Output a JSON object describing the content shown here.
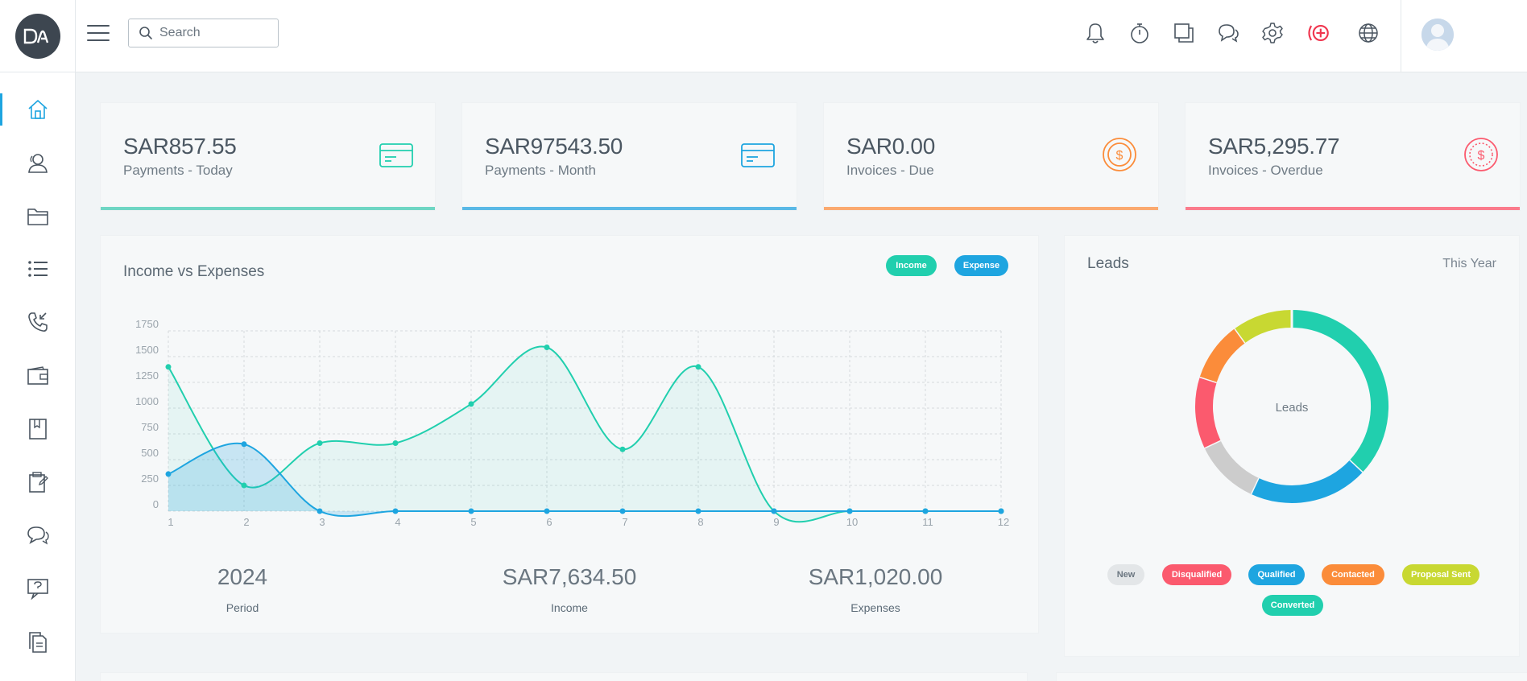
{
  "topbar": {
    "logo_text": "DA",
    "search_placeholder": "Search",
    "icons": [
      "bell-icon",
      "timer-icon",
      "copy-icon",
      "chat-icon",
      "gear-icon",
      "add-circle-icon",
      "globe-icon"
    ]
  },
  "sidebar": {
    "items": [
      "home-icon",
      "contacts-icon",
      "folder-icon",
      "list-icon",
      "phone-icon",
      "wallet-icon",
      "book-icon",
      "clipboard-icon",
      "messages-icon",
      "support-chat-icon",
      "documents-icon"
    ],
    "active": "home-icon"
  },
  "stats": [
    {
      "amount": "SAR857.55",
      "label": "Payments - Today",
      "color": "#21cfae",
      "icon": "credit-card-icon"
    },
    {
      "amount": "SAR97543.50",
      "label": "Payments - Month",
      "color": "#1ea5e0",
      "icon": "credit-card-icon"
    },
    {
      "amount": "SAR0.00",
      "label": "Invoices - Due",
      "color": "#fb8c3a",
      "icon": "dollar-coin-icon"
    },
    {
      "amount": "SAR5,295.77",
      "label": "Invoices - Overdue",
      "color": "#fb5a6e",
      "icon": "dollar-coin-icon"
    }
  ],
  "income_chart": {
    "title": "Income vs Expenses",
    "legend": {
      "income": "Income",
      "expense": "Expense"
    },
    "summary": [
      {
        "value": "2024",
        "label": "Period"
      },
      {
        "value": "SAR7,634.50",
        "label": "Income"
      },
      {
        "value": "SAR1,020.00",
        "label": "Expenses"
      }
    ]
  },
  "chart_data": {
    "type": "area",
    "x": [
      "1",
      "2",
      "3",
      "4",
      "5",
      "6",
      "7",
      "8",
      "9",
      "10",
      "11",
      "12"
    ],
    "ylim": [
      0,
      1750
    ],
    "yticks": [
      0,
      250,
      500,
      750,
      1000,
      1250,
      1500,
      1750
    ],
    "grid": true,
    "series": [
      {
        "name": "Income",
        "color": "#21cfae",
        "values": [
          1400,
          250,
          660,
          660,
          1040,
          1590,
          600,
          1400,
          0,
          0,
          0,
          0
        ]
      },
      {
        "name": "Expense",
        "color": "#1ea5e0",
        "values": [
          360,
          650,
          0,
          0,
          0,
          0,
          0,
          0,
          0,
          0,
          0,
          0
        ]
      }
    ]
  },
  "leads": {
    "title": "Leads",
    "period": "This Year",
    "center_label": "Leads",
    "segments": [
      {
        "name": "Converted",
        "color": "#21cfae",
        "value": 37
      },
      {
        "name": "Qualified",
        "color": "#1ea5e0",
        "value": 20
      },
      {
        "name": "New",
        "color": "#cccccc",
        "value": 11
      },
      {
        "name": "Disqualified",
        "color": "#fb5a6e",
        "value": 12
      },
      {
        "name": "Contacted",
        "color": "#fb8c3a",
        "value": 10
      },
      {
        "name": "Proposal Sent",
        "color": "#c8d832",
        "value": 10
      }
    ],
    "legend": [
      {
        "label": "New",
        "color": "#e3e6e8",
        "text_color": "#6b7680"
      },
      {
        "label": "Disqualified",
        "color": "#fb5a6e",
        "text_color": "#ffffff"
      },
      {
        "label": "Qualified",
        "color": "#1ea5e0",
        "text_color": "#ffffff"
      },
      {
        "label": "Contacted",
        "color": "#fb8c3a",
        "text_color": "#ffffff"
      },
      {
        "label": "Proposal Sent",
        "color": "#c8d832",
        "text_color": "#ffffff"
      },
      {
        "label": "Converted",
        "color": "#21cfae",
        "text_color": "#ffffff"
      }
    ]
  }
}
